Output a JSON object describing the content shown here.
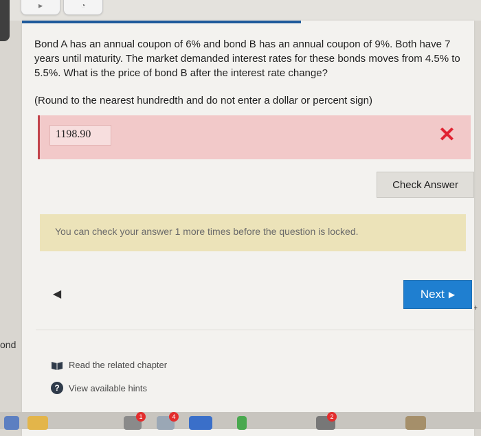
{
  "question": {
    "text": "Bond A has an annual coupon of 6% and bond B has an annual coupon of 9%. Both have 7 years until maturity. The market demanded interest rates for these bonds moves from 4.5% to 5.5%. What is the price of bond B after the interest rate change?",
    "instruction": "(Round to the nearest hundredth and do not enter a dollar or percent sign)"
  },
  "answer": {
    "value": "1198.90",
    "status_icon": "x-mark"
  },
  "buttons": {
    "check": "Check Answer",
    "next": "Next"
  },
  "attempts_message": "You can check your answer 1 more times before the question is locked.",
  "resources": {
    "chapter": "Read the related chapter",
    "hints": "View available hints"
  },
  "side_text": "ond",
  "dock_badges": [
    "1",
    "4",
    "2"
  ],
  "colors": {
    "accent_blue": "#1f7fd0",
    "error_red": "#e02231",
    "error_bg": "#f2c9c9",
    "notice_bg": "#ece3b9"
  }
}
